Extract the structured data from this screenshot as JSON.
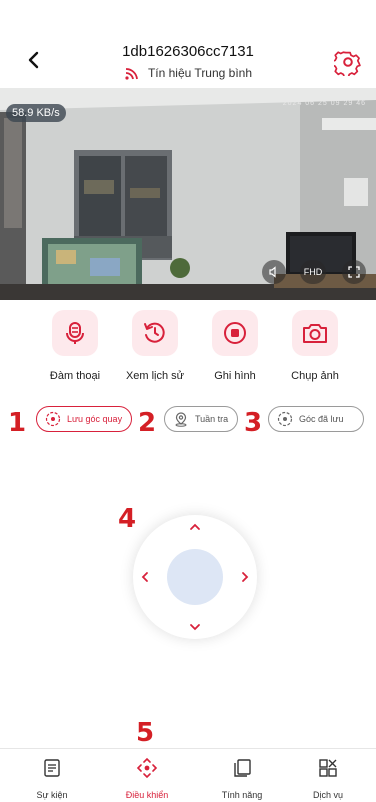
{
  "header": {
    "device_name": "1db1626306cc7131",
    "signal_text": "Tín hiệu Trung bình"
  },
  "video": {
    "speed_badge": "58.9 KB/s",
    "timestamp": "2024 06 25 09 29 46",
    "quality_label": "FHD"
  },
  "actions": [
    {
      "label": "Đàm thoại",
      "icon": "microphone-icon"
    },
    {
      "label": "Xem lịch sử",
      "icon": "history-clock-icon"
    },
    {
      "label": "Ghi hình",
      "icon": "record-icon"
    },
    {
      "label": "Chụp ảnh",
      "icon": "camera-icon"
    }
  ],
  "modes": [
    {
      "label": "Lưu góc quay",
      "icon": "save-angle-icon",
      "active": true
    },
    {
      "label": "Tuần tra",
      "icon": "patrol-pin-icon",
      "active": false
    },
    {
      "label": "Góc đã lưu",
      "icon": "saved-angle-icon",
      "active": false
    }
  ],
  "annotations": [
    "1",
    "2",
    "3",
    "4",
    "5"
  ],
  "tabs": [
    {
      "label": "Sự kiện",
      "icon": "event-list-icon",
      "active": false
    },
    {
      "label": "Điều khiển",
      "icon": "control-dpad-icon",
      "active": true
    },
    {
      "label": "Tính năng",
      "icon": "features-stack-icon",
      "active": false
    },
    {
      "label": "Dịch vụ",
      "icon": "services-grid-icon",
      "active": false
    }
  ],
  "colors": {
    "accent": "#d8213b",
    "accent_light": "#fde9ec",
    "annotation": "#d41f25",
    "joystick_center": "#dde6f5"
  }
}
